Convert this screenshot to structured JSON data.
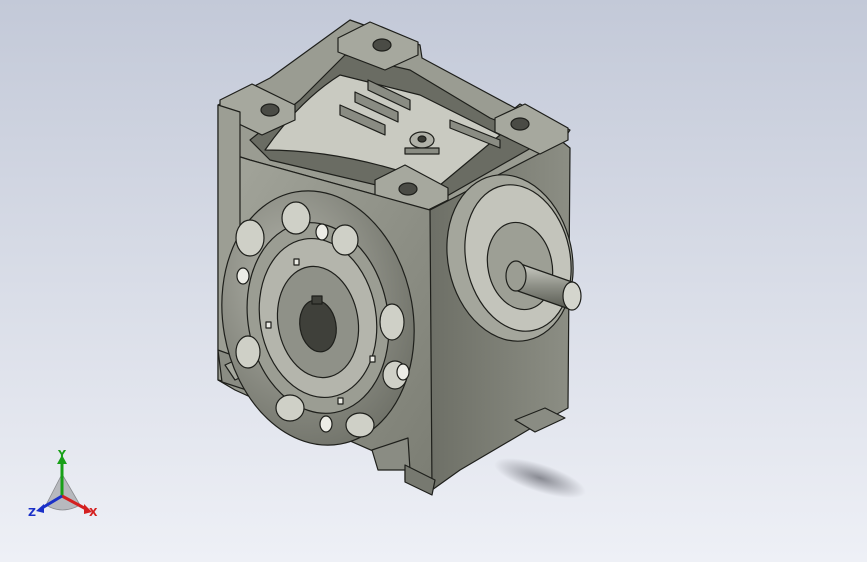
{
  "scene": {
    "background_top": "#c3c9d8",
    "background_bottom": "#eef0f6",
    "part_color": "#8a8c83",
    "part_dark": "#55574f",
    "part_light": "#c9cac1",
    "part_name_icon": "worm-gearbox-3d-model"
  },
  "triad": {
    "x_label": "X",
    "y_label": "Y",
    "z_label": "Z",
    "x_color": "#d42020",
    "y_color": "#18a018",
    "z_color": "#1a30c8"
  }
}
